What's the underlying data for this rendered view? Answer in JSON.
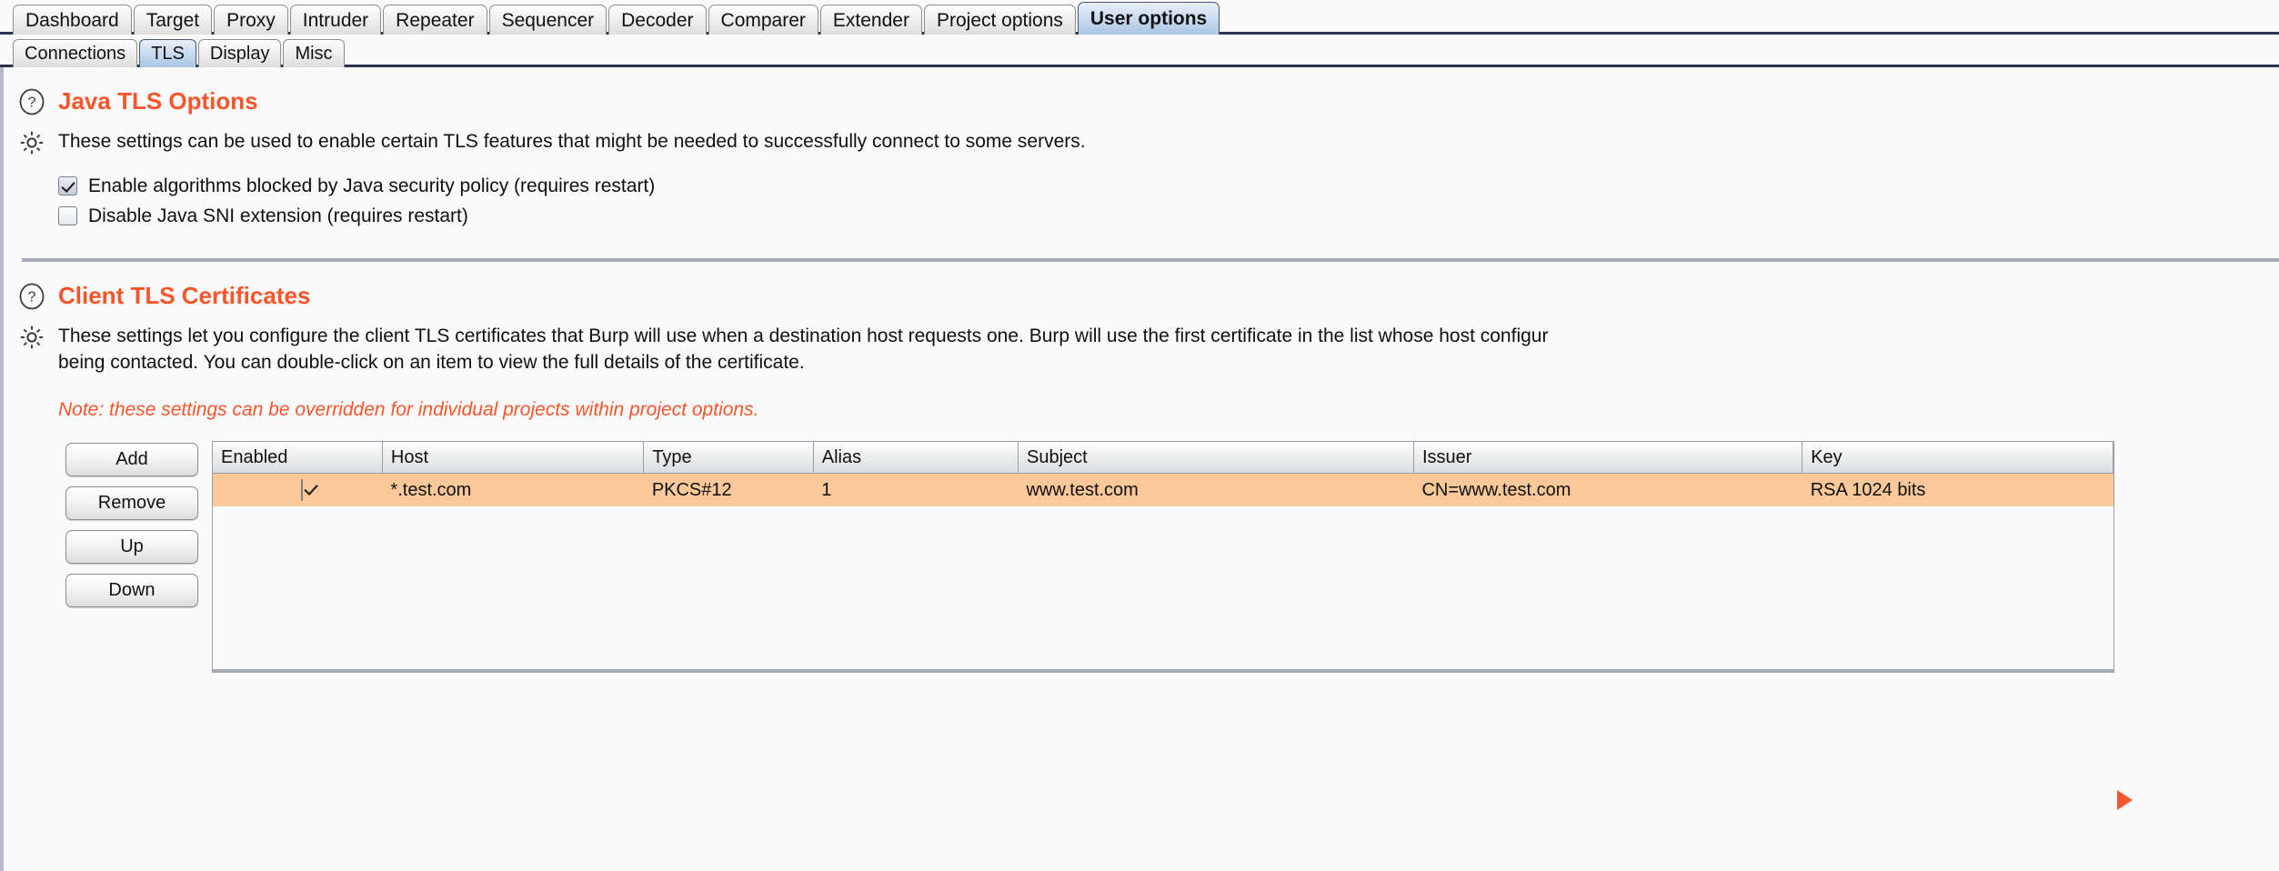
{
  "main_tabs": [
    {
      "label": "Dashboard",
      "selected": false
    },
    {
      "label": "Target",
      "selected": false
    },
    {
      "label": "Proxy",
      "selected": false
    },
    {
      "label": "Intruder",
      "selected": false
    },
    {
      "label": "Repeater",
      "selected": false
    },
    {
      "label": "Sequencer",
      "selected": false
    },
    {
      "label": "Decoder",
      "selected": false
    },
    {
      "label": "Comparer",
      "selected": false
    },
    {
      "label": "Extender",
      "selected": false
    },
    {
      "label": "Project options",
      "selected": false
    },
    {
      "label": "User options",
      "selected": true
    }
  ],
  "sub_tabs": [
    {
      "label": "Connections",
      "selected": false
    },
    {
      "label": "TLS",
      "selected": true
    },
    {
      "label": "Display",
      "selected": false
    },
    {
      "label": "Misc",
      "selected": false
    }
  ],
  "java_tls": {
    "title": "Java TLS Options",
    "help_icon": "question-circle-icon",
    "gear_icon": "gear-icon",
    "description": "These settings can be used to enable certain TLS features that might be needed to successfully connect to some servers.",
    "options": [
      {
        "label": "Enable algorithms blocked by Java security policy (requires restart)",
        "checked": true
      },
      {
        "label": "Disable Java SNI extension (requires restart)",
        "checked": false
      }
    ]
  },
  "client_certs": {
    "title": "Client TLS Certificates",
    "help_icon": "question-circle-icon",
    "gear_icon": "gear-icon",
    "description_line1": "These settings let you configure the client TLS certificates that Burp will use when a destination host requests one. Burp will use the first certificate in the list whose host configur",
    "description_line2": "being contacted. You can double-click on an item to view the full details of the certificate.",
    "note": "Note: these settings can be overridden for individual projects within project options.",
    "buttons": [
      {
        "label": "Add"
      },
      {
        "label": "Remove"
      },
      {
        "label": "Up"
      },
      {
        "label": "Down"
      }
    ],
    "table": {
      "columns": [
        "Enabled",
        "Host",
        "Type",
        "Alias",
        "Subject",
        "Issuer",
        "Key"
      ],
      "rows": [
        {
          "enabled": true,
          "host": "*.test.com",
          "type": "PKCS#12",
          "alias": "1",
          "subject": "www.test.com",
          "issuer": "CN=www.test.com",
          "key": "RSA 1024 bits",
          "selected": true
        }
      ]
    },
    "expander_icon": "expand-arrow-icon"
  },
  "colors": {
    "accent_orange": "#f9552a",
    "selected_row": "#fbc89a",
    "tab_selected": "#c6d9ef",
    "divider": "#a7abb8"
  }
}
